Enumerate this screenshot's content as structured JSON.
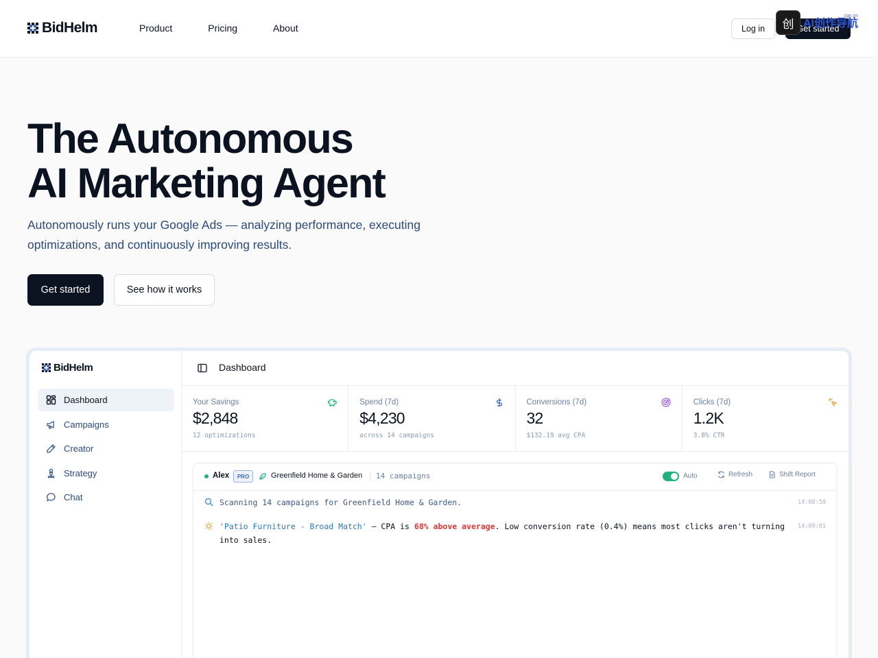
{
  "brand": {
    "name": "BidHelm",
    "accent": "#0b1220"
  },
  "nav": {
    "links": [
      "Product",
      "Pricing",
      "About"
    ],
    "login": "Log in",
    "cta": "Get started"
  },
  "watermark": {
    "logo": "创",
    "text": "AI创作导航",
    "sub": "cgn.cn"
  },
  "hero": {
    "title_line1": "The Autonomous",
    "title_line2": "AI Marketing Agent",
    "subtitle": "Autonomously runs your Google Ads — analyzing performance, executing optimizations, and continuously improving results.",
    "primary_button": "Get started",
    "secondary_button": "See how it works"
  },
  "app": {
    "brand": "BidHelm",
    "sidebar": [
      {
        "label": "Dashboard",
        "icon": "dashboard-grid-icon",
        "active": true
      },
      {
        "label": "Campaigns",
        "icon": "megaphone-icon",
        "active": false
      },
      {
        "label": "Creator",
        "icon": "pencil-icon",
        "active": false
      },
      {
        "label": "Strategy",
        "icon": "chess-piece-icon",
        "active": false
      },
      {
        "label": "Chat",
        "icon": "chat-bubble-icon",
        "active": false
      }
    ],
    "header_title": "Dashboard",
    "stats": [
      {
        "label": "Your Savings",
        "value": "$2,848",
        "sub": "12 optimizations",
        "icon": "piggy-bank-icon",
        "color": "#22b07d"
      },
      {
        "label": "Spend (7d)",
        "value": "$4,230",
        "sub": "across 14 campaigns",
        "icon": "dollar-icon",
        "color": "#3d68b5"
      },
      {
        "label": "Conversions (7d)",
        "value": "32",
        "sub": "$132.19 avg CPA",
        "icon": "target-icon",
        "color": "#a56de0"
      },
      {
        "label": "Clicks (7d)",
        "value": "1.2K",
        "sub": "3.8% CTR",
        "icon": "click-burst-icon",
        "color": "#e6a23c"
      }
    ],
    "feed": {
      "user": "Alex",
      "badge": "PRO",
      "account": "Greenfield Home & Garden",
      "campaign_count": "14 campaigns",
      "auto_label": "Auto",
      "auto_on": true,
      "refresh": "Refresh",
      "shift_report": "Shift Report",
      "lines": [
        {
          "icon": "search-icon",
          "text": "Scanning 14 campaigns for Greenfield Home & Garden.",
          "time": "14:08:58"
        },
        {
          "icon": "lightbulb-icon",
          "campaign": "'Patio Furniture - Broad Match'",
          "mid": " — CPA is ",
          "highlight": "68% above average",
          "rest": ". Low conversion rate (0.4%) means most clicks aren't turning into sales.",
          "time": "14:09:01"
        }
      ]
    }
  }
}
